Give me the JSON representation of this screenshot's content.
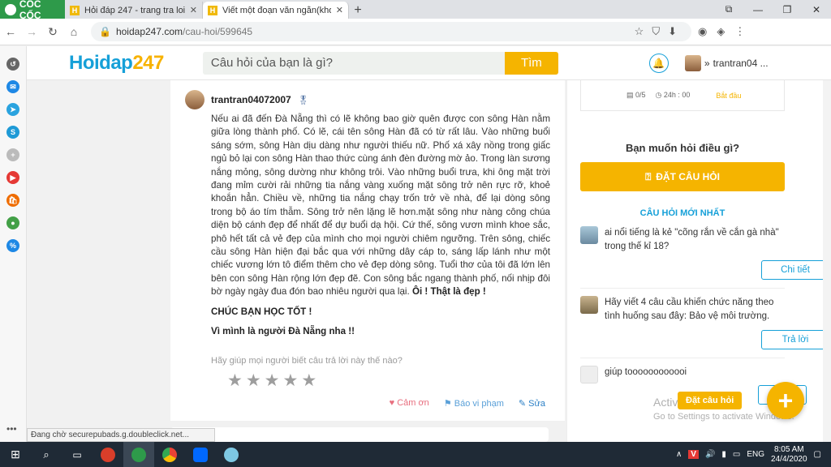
{
  "browser": {
    "brand": "CỐC CỐC",
    "tabs": [
      {
        "title": "Hỏi đáp 247 - trang tra loi",
        "active": false
      },
      {
        "title": "Viết một đoạn văn ngắn(khoả",
        "active": true
      }
    ],
    "url_host": "hoidap247.com",
    "url_path": "/cau-hoi/599645"
  },
  "site": {
    "logo_main": "Hoidap",
    "logo_num": "247",
    "search_placeholder": "Câu hỏi của bạn là gì?",
    "search_button": "Tìm",
    "username": "trantran04 ..."
  },
  "answer": {
    "author": "trantran04072007",
    "body": "Nếu ai đã đến Đà Nẵng thì có lẽ không bao giờ quên được con sông Hàn nằm giữa lòng thành phố. Có lẽ, cái tên sông Hàn đã có từ rất lâu. Vào những buổi sáng sớm, sông Hàn dịu dàng như người thiếu nữ. Phố xá xây nồng trong giấc ngủ bỏ lại con sông Hàn thao thức cùng ánh đèn đường mờ ảo. Trong làn sương nắng mỏng, sông dường như không trôi. Vào những buổi trưa, khi ông mặt trời đang mỉm cười rải những tia nắng vàng xuống mặt sông trở nên rực rỡ, khoẻ khoắn hẳn. Chiều về, những tia nắng chạy trốn trở về nhà, để lại dòng sông trong bộ áo tím thẫm. Sông trở nên lặng lẽ hơn.mặt sông như nàng công chúa diện bộ cánh đẹp để nhất để dự buổi dạ hội. Cứ thế, sông vươn mình khoe sắc, phô hết tất cả vẻ đẹp của mình cho mọi người chiêm ngưỡng. Trên sông, chiếc cầu sông Hàn hiện đại bắc qua với những dây cáp to, sáng lấp lánh như một chiếc vương lớn tô điểm thêm cho vẻ đẹp dòng sông. Tuổi thơ của tôi đã lớn lên bên con sông Hàn rộng lớn đẹp đẽ. Con sông bắc ngang thành phố, nối nhịp đôi bờ ngày ngày đua đón bao nhiêu người qua lại.",
    "body_bold": " Ôi ! Thật là đẹp !",
    "line1": "CHÚC BẠN HỌC TỐT !",
    "line2": "Vì mình là người Đà Nẵng nha !!",
    "help_text": "Hãy giúp mọi người biết câu trả lời này thế nào?",
    "rating": {
      "filled": 0,
      "max": 5
    },
    "thank": "Cảm ơn",
    "report": "Báo vi phạm",
    "edit": "Sửa"
  },
  "sidebar": {
    "stat_count": "0/5",
    "stat_time": "24h : 00",
    "stat_start": "Bắt đầu",
    "ask_title": "Bạn muốn hỏi điều gì?",
    "ask_button": "ĐẶT CÂU HỎI",
    "new_title": "CÂU HỎI MỚI NHẤT",
    "questions": [
      {
        "text": "ai nổi tiếng là kẻ \"cõng rắn về cắn gà nhà\" trong thế kỉ 18?",
        "button": "Chi tiết"
      },
      {
        "text": "Hãy viết 4 câu cầu khiến chức năng theo tình huống sau đây: Bảo vệ môi trường.",
        "button": "Trả lời"
      },
      {
        "text": "giúp toooooooooooi",
        "button": ""
      }
    ],
    "fab_label": "Đặt câu hỏi",
    "fab_icon": "+",
    "activate_title": "Activate",
    "activate_sub": "Go to Settings to activate Windows."
  },
  "status_text": "Đang chờ securepubads.g.doubleclick.net...",
  "taskbar": {
    "lang": "ENG",
    "time": "8:05 AM",
    "date": "24/4/2020"
  },
  "colors": {
    "accent": "#f5b400",
    "link": "#16a0d8"
  }
}
